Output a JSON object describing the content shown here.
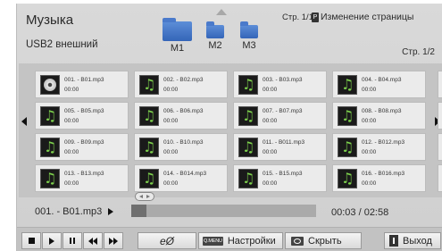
{
  "header": {
    "title": "Музыка",
    "device": "USB2 внешний",
    "folders": [
      "M1",
      "M2",
      "M3"
    ],
    "page_indicator": "Стр. 1/1",
    "page_change_key": "P",
    "page_change_label": "Изменение страницы",
    "list_page": "Стр. 1/2"
  },
  "grid": {
    "tiles": [
      {
        "name": "001. - B01.mp3",
        "time": "00:00",
        "icon": "cd-icon"
      },
      {
        "name": "002. - B02.mp3",
        "time": "00:00",
        "icon": "music-note-icon"
      },
      {
        "name": "003. - B03.mp3",
        "time": "00:00",
        "icon": "music-note-icon"
      },
      {
        "name": "004. - B04.mp3",
        "time": "00:00",
        "icon": "music-note-icon"
      },
      {
        "name": "005. - B05.mp3",
        "time": "00:00",
        "icon": "music-note-icon"
      },
      {
        "name": "006. - B06.mp3",
        "time": "00:00",
        "icon": "music-note-icon"
      },
      {
        "name": "007. - B07.mp3",
        "time": "00:00",
        "icon": "music-note-icon"
      },
      {
        "name": "008. - B08.mp3",
        "time": "00:00",
        "icon": "music-note-icon"
      },
      {
        "name": "009. - B09.mp3",
        "time": "00:00",
        "icon": "music-note-icon"
      },
      {
        "name": "010. - B10.mp3",
        "time": "00:00",
        "icon": "music-note-icon"
      },
      {
        "name": "011. - B011.mp3",
        "time": "00:00",
        "icon": "music-note-icon"
      },
      {
        "name": "012. - B012.mp3",
        "time": "00:00",
        "icon": "music-note-icon"
      },
      {
        "name": "013. - B13.mp3",
        "time": "00:00",
        "icon": "music-note-icon"
      },
      {
        "name": "014. - B014.mp3",
        "time": "00:00",
        "icon": "music-note-icon"
      },
      {
        "name": "015. - B15.mp3",
        "time": "00:00",
        "icon": "music-note-icon"
      },
      {
        "name": "016. - B016.mp3",
        "time": "00:00",
        "icon": "music-note-icon"
      }
    ]
  },
  "player": {
    "now_playing": "001. - B01.mp3",
    "time": "00:03 / 02:58",
    "progress_fraction": 0.017
  },
  "controls": {
    "settings_key": "Q.MENU",
    "settings_label": "Настройки",
    "hide_label": "Скрыть",
    "exit_label": "Выход",
    "energy_glyph": "eØ"
  },
  "colors": {
    "folder_blue": "#3f73c6",
    "note_green": "#7ccf4c",
    "background": "#d6d6d6"
  }
}
